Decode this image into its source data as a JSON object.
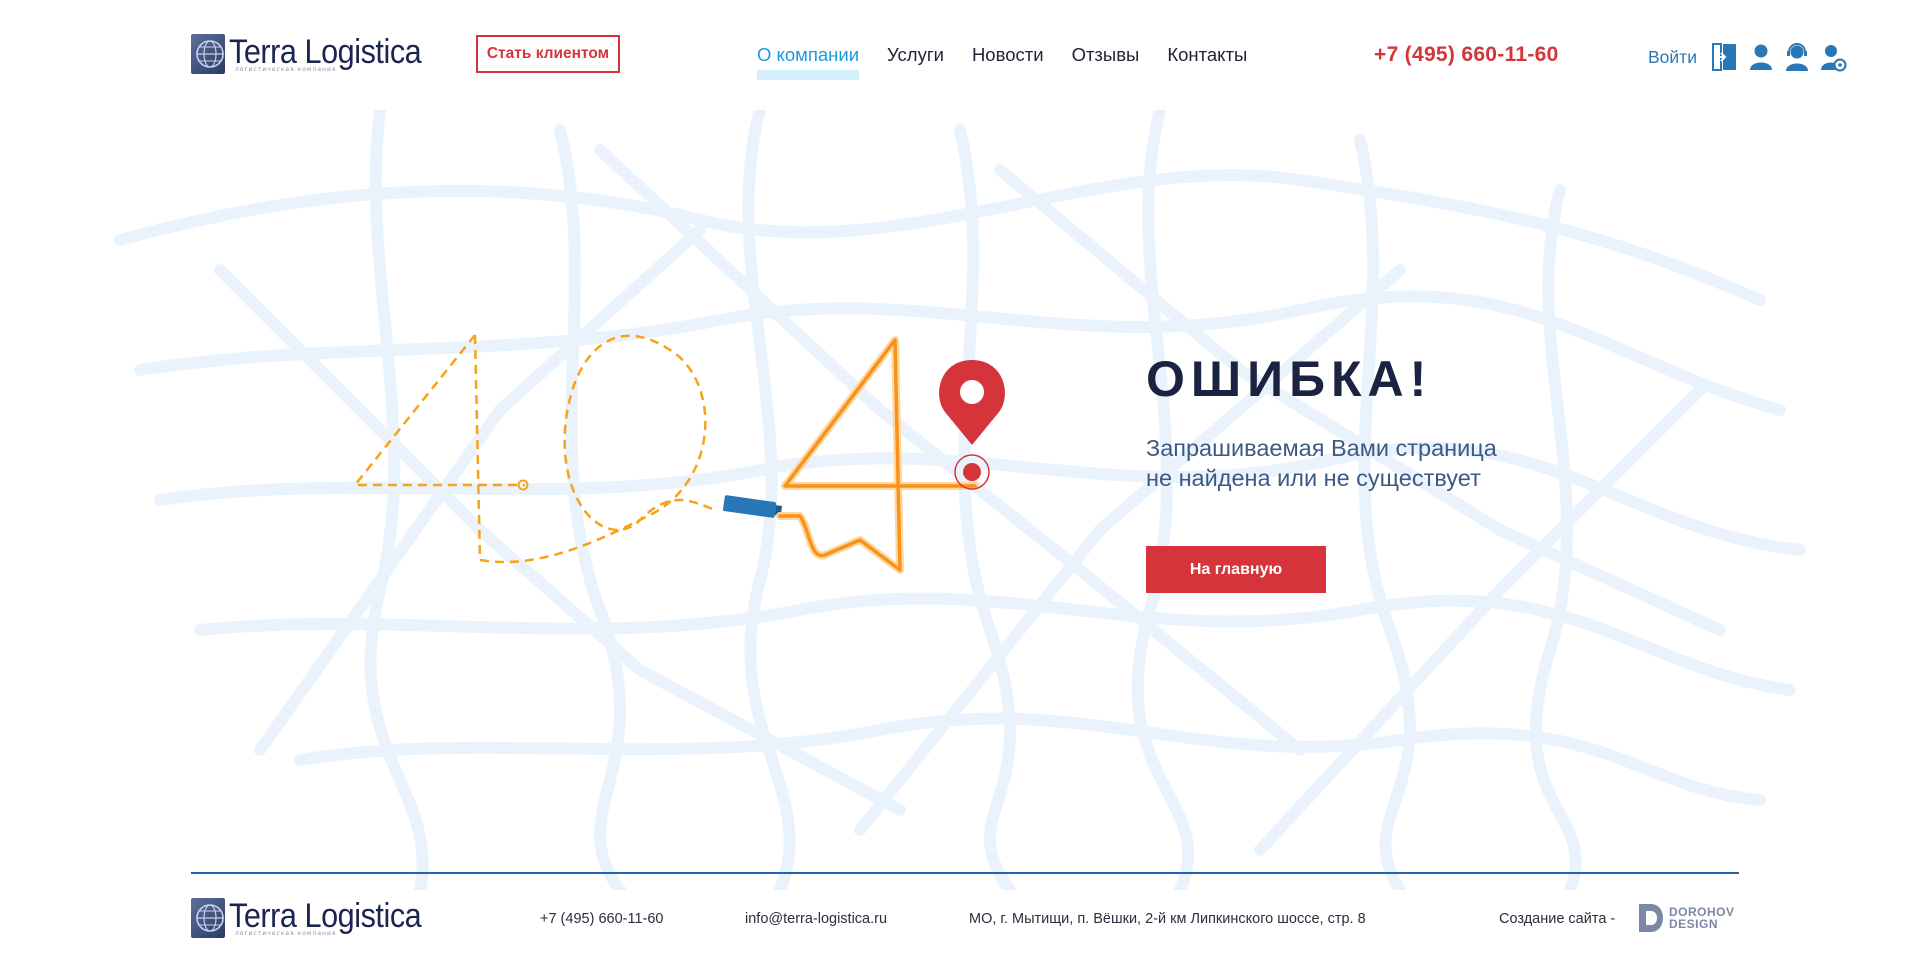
{
  "brand": {
    "name": "Terra Logistica",
    "tagline": "логистическая компания"
  },
  "header": {
    "become_client": "Стать клиентом",
    "nav": [
      {
        "label": "О компании",
        "active": true
      },
      {
        "label": "Услуги",
        "active": false
      },
      {
        "label": "Новости",
        "active": false
      },
      {
        "label": "Отзывы",
        "active": false
      },
      {
        "label": "Контакты",
        "active": false
      }
    ],
    "phone": "+7 (495) 660-11-60",
    "login_label": "Войти",
    "login_icons": [
      "login-door-icon",
      "client-user-icon",
      "operator-headset-icon",
      "admin-user-gear-icon"
    ]
  },
  "error": {
    "code": "404",
    "title": "ОШИБКА!",
    "message_line1": "Запрашиваемая Вами страница",
    "message_line2": "не найдена или не существует",
    "home_button": "На главную"
  },
  "footer": {
    "phone": "+7 (495) 660-11-60",
    "email": "info@terra-logistica.ru",
    "address": "МО, г. Мытищи, п. Вёшки, 2-й км Липкинского шоссе, стр. 8",
    "credit": "Создание сайта -",
    "dev_name_line1": "DOROHOV",
    "dev_name_line2": "DESIGN"
  },
  "colors": {
    "accent_red": "#d5353a",
    "nav_active": "#1b9ae0",
    "footer_line": "#2464a6",
    "map_lines": "#eaf3fc",
    "path_orange": "#f7a21b"
  }
}
